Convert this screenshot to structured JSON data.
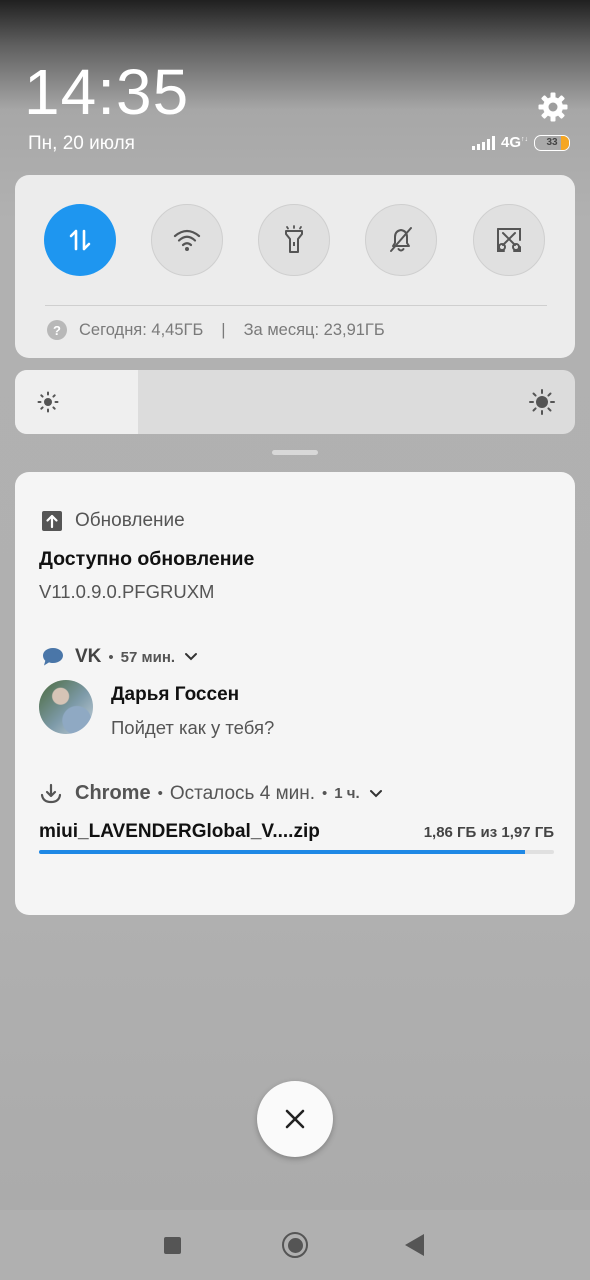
{
  "status_bar": {
    "time": "14:35",
    "date": "Пн, 20 июля",
    "network": "4G",
    "battery_level": "33",
    "battery_color": "#f5a623"
  },
  "quick_settings": {
    "toggles": [
      {
        "icon": "mobile-data-icon",
        "active": true
      },
      {
        "icon": "wifi-icon",
        "active": false
      },
      {
        "icon": "flashlight-icon",
        "active": false
      },
      {
        "icon": "silent-mode-icon",
        "active": false
      },
      {
        "icon": "screenshot-icon",
        "active": false
      }
    ],
    "usage_today": "Сегодня: 4,45ГБ",
    "separator": "|",
    "usage_month": "За месяц: 23,91ГБ",
    "accent_color": "#1e96f0"
  },
  "brightness": {
    "level": 0.22
  },
  "notifications": {
    "update": {
      "app": "Обновление",
      "title": "Доступно обновление",
      "text": "V11.0.9.0.PFGRUXM"
    },
    "vk": {
      "app": "VK",
      "time": "57 мин.",
      "sender": "Дарья Госсен",
      "message": "Пойдет как у тебя?"
    },
    "chrome": {
      "app": "Chrome",
      "status": "Осталось 4 мин.",
      "time": "1 ч.",
      "file": "miui_LAVENDERGlobal_V....zip",
      "size": "1,86 ГБ из 1,97 ГБ",
      "progress": 0.944
    }
  },
  "nav": {
    "buttons": [
      "recents-button",
      "home-button",
      "back-button"
    ]
  }
}
